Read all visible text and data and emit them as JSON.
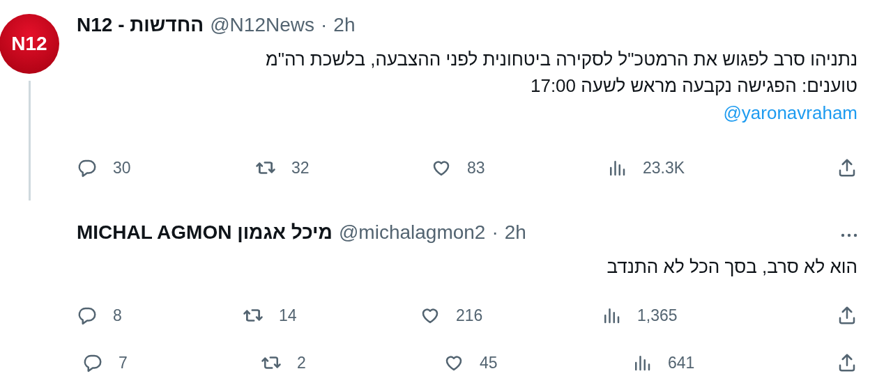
{
  "tweets": [
    {
      "name": "N12 - החדשות",
      "handle": "@N12News",
      "separator": "·",
      "time": "2h",
      "avatar": {
        "text": "N12"
      },
      "thread_line": true,
      "more": false,
      "text": "נתניהו סרב לפגוש את הרמטכ\"ל לסקירה ביטחונית לפני ההצבעה, בלשכת רה\"מ\nטוענים: הפגישה נקבעה מראש לשעה 17:00",
      "mention": "@yaronavraham",
      "actions": {
        "reply": "30",
        "retweet": "32",
        "like": "83",
        "views": "23.3K"
      }
    },
    {
      "name": "MICHAL AGMON מיכל אגמון",
      "handle": "@michalagmon2",
      "separator": "·",
      "time": "2h",
      "thread_line": false,
      "more": true,
      "text": "הוא לא סרב, בסך הכל לא התנדב",
      "actions": {
        "reply": "8",
        "retweet": "14",
        "like": "216",
        "views": "1,365"
      }
    }
  ],
  "bottom_actions": {
    "reply": "7",
    "retweet": "2",
    "like": "45",
    "views": "641"
  }
}
